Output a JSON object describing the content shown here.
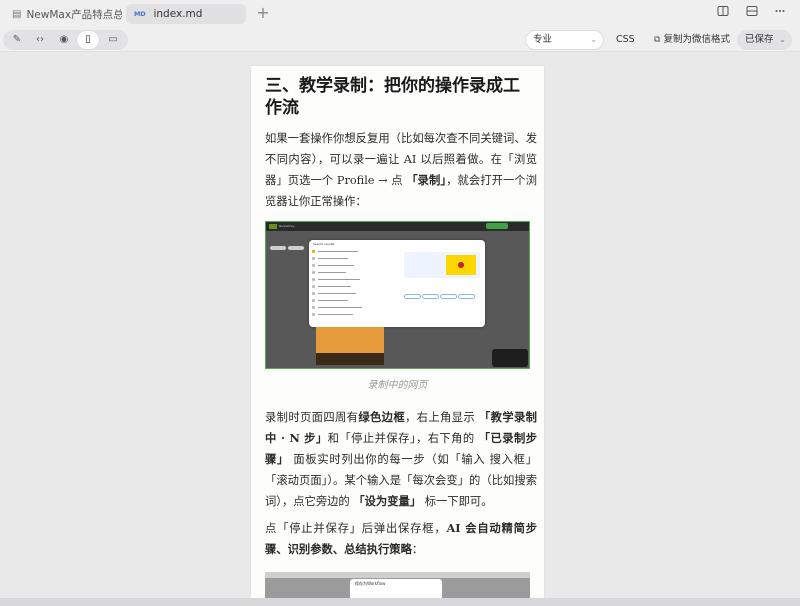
{
  "tabs": [
    {
      "label": "NewMax产品特点总结",
      "icon": "document-icon",
      "active": false
    },
    {
      "label": "index.md",
      "badge": "MD",
      "active": true
    }
  ],
  "tab_add_symbol": "+",
  "window_controls": [
    "split-vertical-icon",
    "split-horizontal-icon",
    "more-icon"
  ],
  "toolbar": {
    "modes": [
      {
        "name": "edit",
        "icon": "pencil-icon",
        "glyph": "✎"
      },
      {
        "name": "code",
        "icon": "code-icon",
        "glyph": "‹›"
      },
      {
        "name": "preview",
        "icon": "eye-icon",
        "glyph": "◉"
      },
      {
        "name": "mobile",
        "icon": "phone-icon",
        "glyph": "▯",
        "selected": true
      },
      {
        "name": "tablet",
        "icon": "tablet-icon",
        "glyph": "▭"
      }
    ],
    "theme_select": "专业",
    "css_label": "CSS",
    "copy_label": "复制为微信格式",
    "saved_label": "已保存"
  },
  "document": {
    "heading": "三、教学录制：把你的操作录成工作流",
    "para1": {
      "t1": "如果一套操作你想反复用（比如每次查不同关键词、发不同内容），可以录一遍让 AI 以后照着做。在「浏览器」页选一个 Profile → 点 ",
      "b1": "「录制」",
      "t2": "，就会打开一个浏览器让你正常操作："
    },
    "figure_caption": "录制中的网页",
    "figure_screenshot_text": {
      "brand": "NewsRiley",
      "dialog_title": "Search results"
    },
    "para2": {
      "t1": "录制时页面四周有",
      "b1": "绿色边框",
      "t2": "，右上角显示 ",
      "b2": "「教学录制中 · N 步」",
      "t3": "和「停止并保存」，右下角的 ",
      "b3": "「已录制步骤」",
      "t4": " 面板实时列出你的每一步（如「输入 搜入框」「滚动页面」）。某个输入是「每次会变」的（比如搜索词），点它旁边的 ",
      "b4": "「设为变量」",
      "t5": " 标一下即可。"
    },
    "para3": {
      "t1": "点「停止并保存」后弹出保存框，",
      "b1": "AI 会自动精简步骤、识别参数、总结执行策略",
      "t2": "："
    },
    "figure2_dialog_title": "保存为Workflow"
  },
  "colors": {
    "accent_green": "#4caf50",
    "background": "#e9e9ea",
    "page": "#fdfdfc"
  }
}
